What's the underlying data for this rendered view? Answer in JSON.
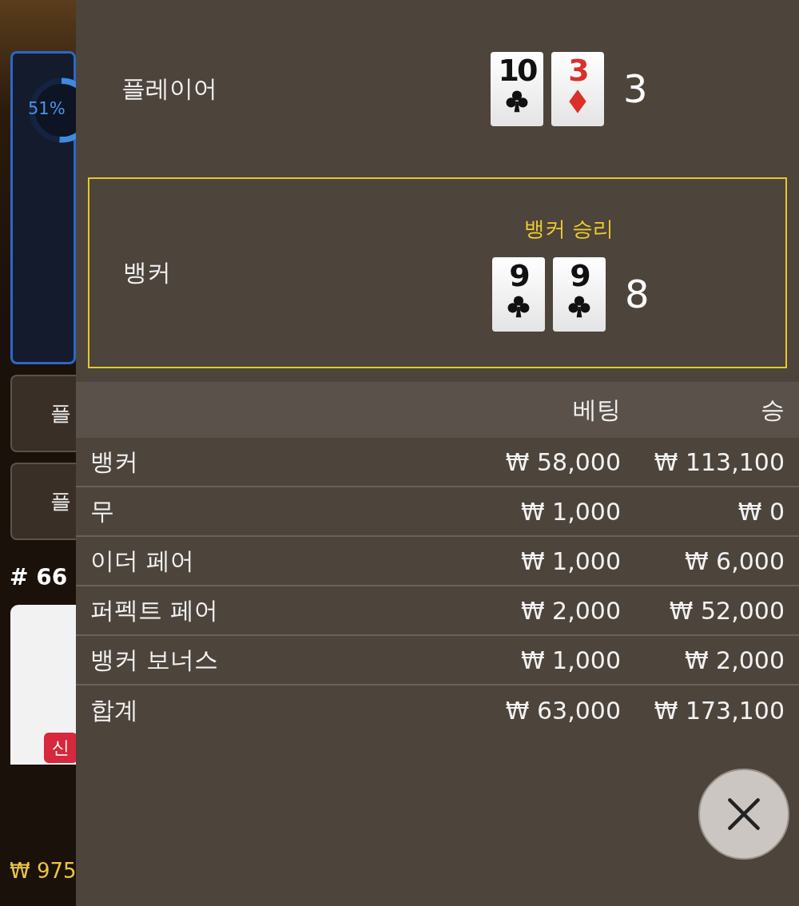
{
  "background": {
    "win_meter": {
      "label": "51%"
    },
    "side_buttons": [
      "플",
      "플"
    ],
    "round": "# 66",
    "badge": "신",
    "balance": "₩ 975"
  },
  "result": {
    "hands": [
      {
        "name": "플레이어",
        "winner": false,
        "total": "3",
        "cards": [
          {
            "rank": "10",
            "kind": "clubs"
          },
          {
            "rank": "3",
            "kind": "diamonds"
          }
        ]
      },
      {
        "name": "뱅커",
        "winner": true,
        "banner": "뱅커 승리",
        "total": "8",
        "cards": [
          {
            "rank": "9",
            "kind": "clubs"
          },
          {
            "rank": "9",
            "kind": "clubs"
          }
        ]
      }
    ],
    "table": {
      "columns": [
        "베팅",
        "승"
      ],
      "rows": [
        {
          "label": "뱅커",
          "bet": "₩ 58,000",
          "win": "₩ 113,100"
        },
        {
          "label": "무",
          "bet": "₩ 1,000",
          "win": "₩ 0"
        },
        {
          "label": "이더 페어",
          "bet": "₩ 1,000",
          "win": "₩ 6,000"
        },
        {
          "label": "퍼펙트 페어",
          "bet": "₩ 2,000",
          "win": "₩ 52,000"
        },
        {
          "label": "뱅커 보너스",
          "bet": "₩ 1,000",
          "win": "₩ 2,000"
        }
      ],
      "total": {
        "label": "합계",
        "bet": "₩ 63,000",
        "win": "₩ 173,100"
      }
    }
  }
}
